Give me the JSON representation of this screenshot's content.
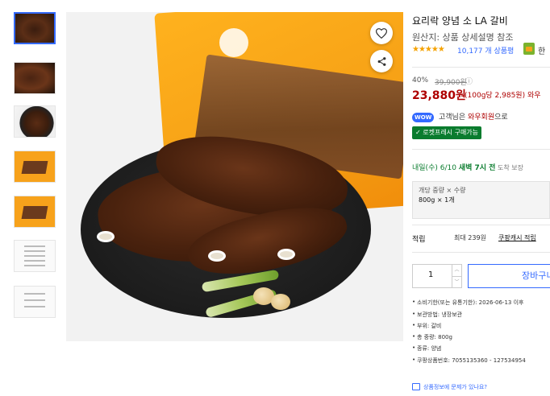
{
  "thumbnails": [
    {
      "name": "thumb-1-meat-package"
    },
    {
      "name": "thumb-2-meat-closeup"
    },
    {
      "name": "thumb-3-meat-plate"
    },
    {
      "name": "thumb-4-package"
    },
    {
      "name": "thumb-5-package-open"
    },
    {
      "name": "thumb-6-label"
    },
    {
      "name": "thumb-7-nutrition"
    }
  ],
  "product": {
    "title": "요리락 양념 소 LA 갈비",
    "origin": "원산지: 상품 상세설명 참조",
    "rating_stars": "★★★★★",
    "review_count": "10,177 개 상품평",
    "badge_text": "한"
  },
  "pricing": {
    "discount": "40%",
    "original_price": "39,900원",
    "info_icon": "ⓘ",
    "sale_price": "23,880원",
    "unit_price": "(100g당 2,985원) 와우",
    "wow_badge": "WOW",
    "wow_text_prefix": "고객님은 ",
    "wow_text_highlight": "와우회원",
    "wow_text_suffix": "으로",
    "rocket_fresh": "✓ 로켓프레시 구매가능"
  },
  "delivery": {
    "date": "내일(수) 6/10 ",
    "highlight": "새벽 7시 전",
    "suffix": " 도착 보장"
  },
  "option": {
    "label": "개당 중량 × 수량",
    "value": "800g × 1개"
  },
  "points": {
    "label": "적립",
    "text": "최대 239원",
    "link": "쿠팡캐시 적립"
  },
  "purchase": {
    "quantity": "1",
    "cart_label": "장바구니"
  },
  "details": [
    "소비기한(또는 유통기한): 2026-06-13 이후",
    "보관방법: 냉장보관",
    "부위: 갈비",
    "총 중량: 800g",
    "종류: 양념",
    "쿠팡상품번호: 7055135360 - 127534954"
  ],
  "report_link": "상품정보에 문제가 있나요?",
  "icons": {
    "wishlist": "heart-icon",
    "share": "share-icon"
  },
  "colors": {
    "accent_blue": "#346aff",
    "price_red": "#ae0000",
    "rocket_green": "#0a7c2e",
    "star_orange": "#f5a200"
  }
}
